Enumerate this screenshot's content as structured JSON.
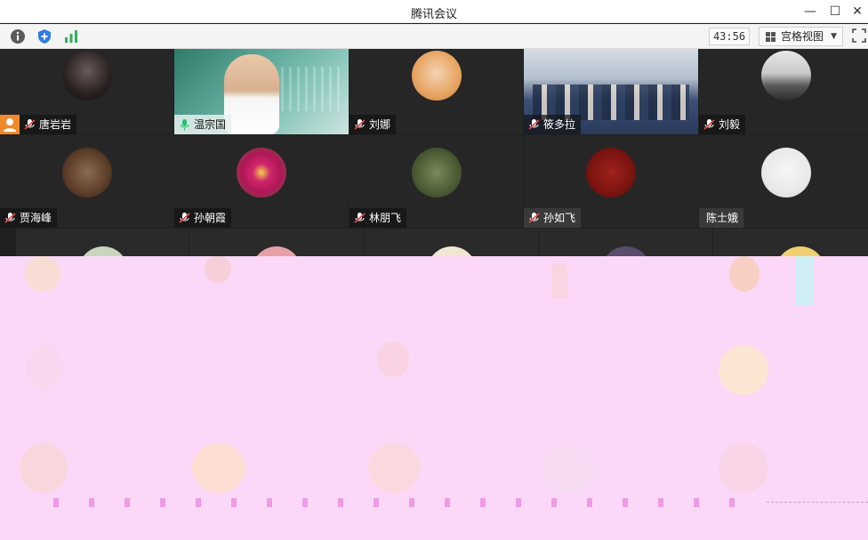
{
  "window": {
    "title": "腾讯会议"
  },
  "toolbar": {
    "timer": "43:56",
    "view_label": "宫格视图"
  },
  "participants": {
    "row1": [
      {
        "name": "唐岩岩",
        "mic": "muted"
      },
      {
        "name": "温宗国",
        "mic": "speaking"
      },
      {
        "name": "刘娜",
        "mic": "muted"
      },
      {
        "name": "筱多拉",
        "mic": "muted"
      },
      {
        "name": "刘毅",
        "mic": "muted"
      }
    ],
    "row2": [
      {
        "name": "贾海峰",
        "mic": "muted"
      },
      {
        "name": "孙朝霞",
        "mic": "muted"
      },
      {
        "name": "林朋飞",
        "mic": "muted"
      },
      {
        "name": "孙如飞",
        "mic": "muted"
      },
      {
        "name": "陈士娥",
        "mic": "muted"
      }
    ]
  },
  "colors": {
    "titlebar": "#ffffff",
    "toolbar": "#f4f4f4",
    "tile_bg": "#262626",
    "speaking_mic": "#22c06a",
    "muted_mic": "#e84a4a",
    "glitch_overlay": "#fbd8f7"
  }
}
